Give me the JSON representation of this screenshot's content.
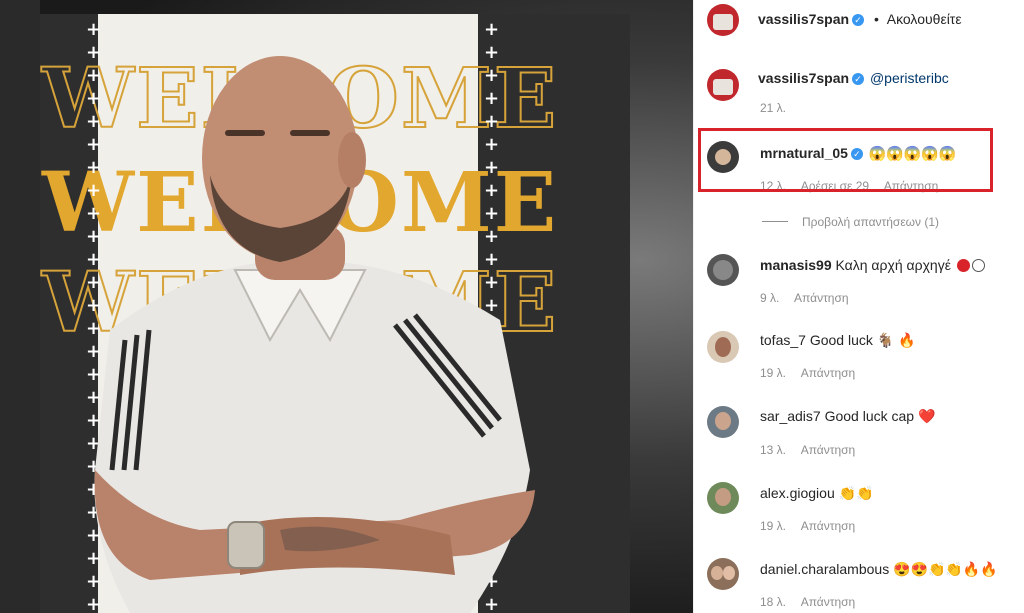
{
  "header": {
    "username": "vassilis7span",
    "separator": "•",
    "follow_label": "Ακολουθείτε"
  },
  "caption": {
    "username": "vassilis7span",
    "mention": "@peristeribc",
    "time": "21 λ."
  },
  "poster": {
    "headline": "WELCOME",
    "plus_marks": "+\n+\n+\n+\n+\n+\n+\n+\n+\n+\n+\n+\n+\n+\n+\n+\n+\n+\n+\n+\n+\n+\n+\n+\n+\n+"
  },
  "comments": [
    {
      "username": "mrnatural_05",
      "verified": true,
      "text": "😱😱😱😱😱",
      "time": "12 λ.",
      "likes": "Αρέσει σε 29",
      "reply": "Απάντηση"
    },
    {
      "username": "manasis99",
      "verified": false,
      "text": "Καλη αρχή αρχηγέ",
      "time": "9 λ.",
      "likes": "",
      "reply": "Απάντηση"
    },
    {
      "username": "tofas_7",
      "verified": false,
      "text": "Good luck 🐐 🔥",
      "time": "19 λ.",
      "likes": "",
      "reply": "Απάντηση"
    },
    {
      "username": "sar_adis7",
      "verified": false,
      "text": "Good luck cap ❤️",
      "time": "13 λ.",
      "likes": "",
      "reply": "Απάντηση"
    },
    {
      "username": "alex.giogiou",
      "verified": false,
      "text": "👏👏",
      "time": "19 λ.",
      "likes": "",
      "reply": "Απάντηση"
    },
    {
      "username": "daniel.charalambous",
      "verified": false,
      "text": "😍😍👏👏🔥🔥",
      "time": "18 λ.",
      "likes": "",
      "reply": "Απάντηση"
    }
  ],
  "view_replies": "Προβολή απαντήσεων (1)",
  "colors": {
    "accent_gold": "#e2a72e",
    "highlight_red": "#d9232a",
    "verified_blue": "#3897f0",
    "meta_gray": "#8e8e8e"
  }
}
